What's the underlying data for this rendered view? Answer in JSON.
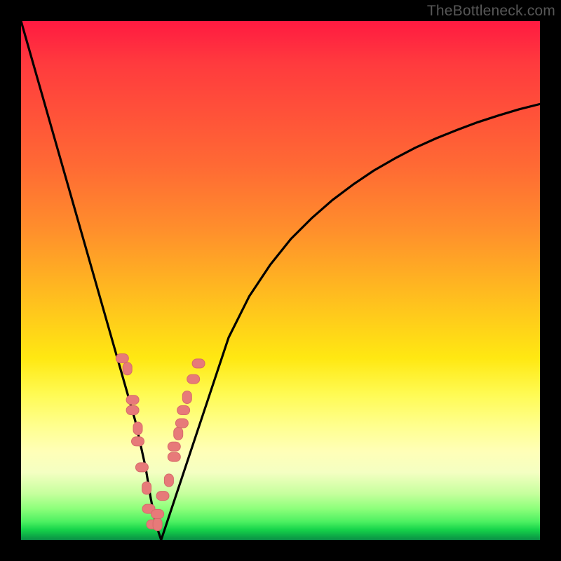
{
  "watermark": "TheBottleneck.com",
  "domain": "Chart",
  "colors": {
    "background_frame": "#000000",
    "curve": "#000000",
    "marker_fill": "#e77a79",
    "marker_stroke": "#d66b6a",
    "gradient_top": "#ff1a41",
    "gradient_bottom": "#0a8f46"
  },
  "chart_data": {
    "type": "line",
    "title": "",
    "xlabel": "",
    "ylabel": "",
    "xlim": [
      0,
      100
    ],
    "ylim": [
      0,
      100
    ],
    "grid": false,
    "legend": false,
    "annotations": [],
    "series": [
      {
        "name": "bottleneck-curve",
        "x": [
          0,
          2,
          4,
          6,
          8,
          10,
          12,
          14,
          16,
          18,
          20,
          22,
          24,
          25,
          26,
          27,
          28,
          30,
          32,
          34,
          36,
          38,
          40,
          44,
          48,
          52,
          56,
          60,
          64,
          68,
          72,
          76,
          80,
          84,
          88,
          92,
          96,
          100
        ],
        "values": [
          100,
          93,
          86,
          79,
          72,
          65,
          58,
          51,
          44,
          37,
          30,
          23,
          14,
          8,
          3,
          0,
          3,
          9,
          15,
          21,
          27,
          33,
          39,
          47,
          53,
          58,
          62,
          65.5,
          68.5,
          71.2,
          73.5,
          75.6,
          77.4,
          79,
          80.5,
          81.8,
          83,
          84
        ]
      }
    ],
    "markers": {
      "name": "benchmark-points",
      "x": [
        19.5,
        20.5,
        21.5,
        21.5,
        22.5,
        22.5,
        23.3,
        24.2,
        24.6,
        25.4,
        26.3,
        26.3,
        27.3,
        28.5,
        29.5,
        29.5,
        30.3,
        31.0,
        31.3,
        32.0,
        33.2,
        34.2
      ],
      "values": [
        35.0,
        33.0,
        27.0,
        25.0,
        21.5,
        19.0,
        14.0,
        10.0,
        6.0,
        3.0,
        3.0,
        5.0,
        8.5,
        11.5,
        16.0,
        18.0,
        20.5,
        22.5,
        25.0,
        27.5,
        31.0,
        34.0
      ]
    }
  }
}
